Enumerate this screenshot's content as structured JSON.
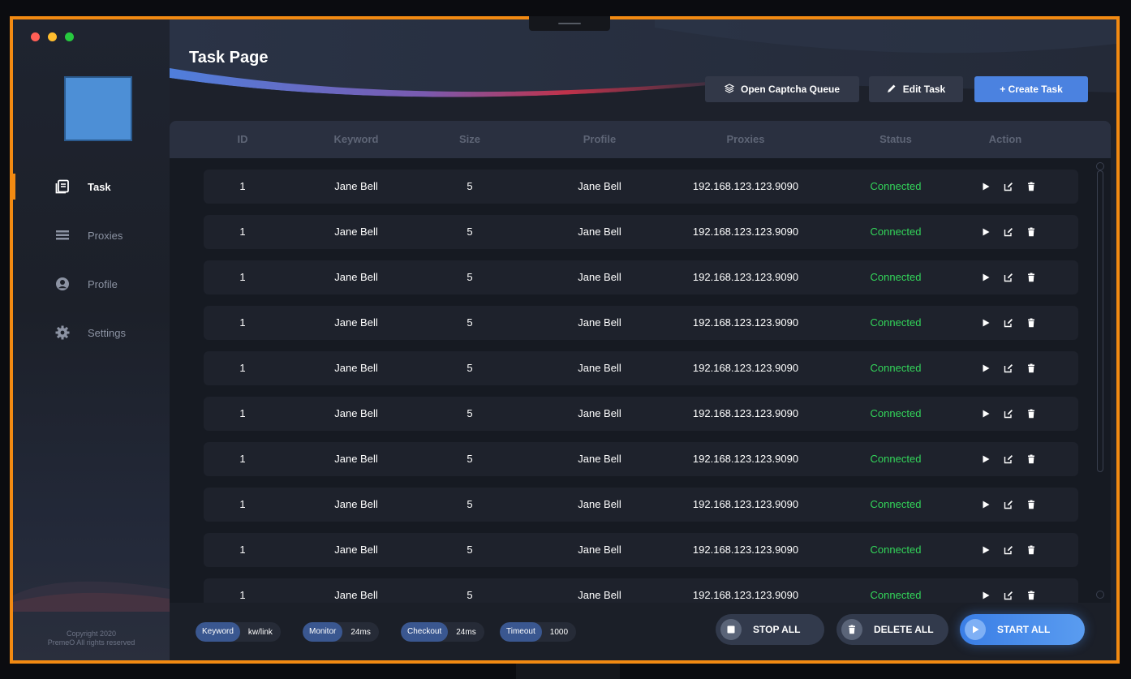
{
  "sidebar": {
    "items": [
      {
        "label": "Task",
        "icon": "tasks-icon",
        "active": true
      },
      {
        "label": "Proxies",
        "icon": "list-icon",
        "active": false
      },
      {
        "label": "Profile",
        "icon": "user-circle-icon",
        "active": false
      },
      {
        "label": "Settings",
        "icon": "gear-icon",
        "active": false
      }
    ],
    "copyright_line1": "Copyright 2020",
    "copyright_line2": "PremeO All rights reserved"
  },
  "header": {
    "title": "Task Page",
    "captcha_label": "Open Captcha Queue",
    "edit_label": "Edit Task",
    "create_label": "+ Create Task"
  },
  "table": {
    "columns": [
      "ID",
      "Keyword",
      "Size",
      "Profile",
      "Proxies",
      "Status",
      "Action"
    ],
    "rows": [
      {
        "id": "1",
        "keyword": "Jane Bell",
        "size": "5",
        "profile": "Jane Bell",
        "proxy": "192.168.123.123.9090",
        "status": "Connected"
      },
      {
        "id": "1",
        "keyword": "Jane Bell",
        "size": "5",
        "profile": "Jane Bell",
        "proxy": "192.168.123.123.9090",
        "status": "Connected"
      },
      {
        "id": "1",
        "keyword": "Jane Bell",
        "size": "5",
        "profile": "Jane Bell",
        "proxy": "192.168.123.123.9090",
        "status": "Connected"
      },
      {
        "id": "1",
        "keyword": "Jane Bell",
        "size": "5",
        "profile": "Jane Bell",
        "proxy": "192.168.123.123.9090",
        "status": "Connected"
      },
      {
        "id": "1",
        "keyword": "Jane Bell",
        "size": "5",
        "profile": "Jane Bell",
        "proxy": "192.168.123.123.9090",
        "status": "Connected"
      },
      {
        "id": "1",
        "keyword": "Jane Bell",
        "size": "5",
        "profile": "Jane Bell",
        "proxy": "192.168.123.123.9090",
        "status": "Connected"
      },
      {
        "id": "1",
        "keyword": "Jane Bell",
        "size": "5",
        "profile": "Jane Bell",
        "proxy": "192.168.123.123.9090",
        "status": "Connected"
      },
      {
        "id": "1",
        "keyword": "Jane Bell",
        "size": "5",
        "profile": "Jane Bell",
        "proxy": "192.168.123.123.9090",
        "status": "Connected"
      },
      {
        "id": "1",
        "keyword": "Jane Bell",
        "size": "5",
        "profile": "Jane Bell",
        "proxy": "192.168.123.123.9090",
        "status": "Connected"
      },
      {
        "id": "1",
        "keyword": "Jane Bell",
        "size": "5",
        "profile": "Jane Bell",
        "proxy": "192.168.123.123.9090",
        "status": "Connected"
      }
    ]
  },
  "footer": {
    "chips": [
      {
        "label": "Keyword",
        "value": "kw/link"
      },
      {
        "label": "Monitor",
        "value": "24ms"
      },
      {
        "label": "Checkout",
        "value": "24ms"
      },
      {
        "label": "Timeout",
        "value": "1000"
      }
    ],
    "stop_label": "STOP ALL",
    "delete_label": "DELETE ALL",
    "start_label": "START ALL"
  },
  "colors": {
    "accent": "#f28a12",
    "primary": "#4b82e0",
    "status_connected": "#33d65a"
  }
}
